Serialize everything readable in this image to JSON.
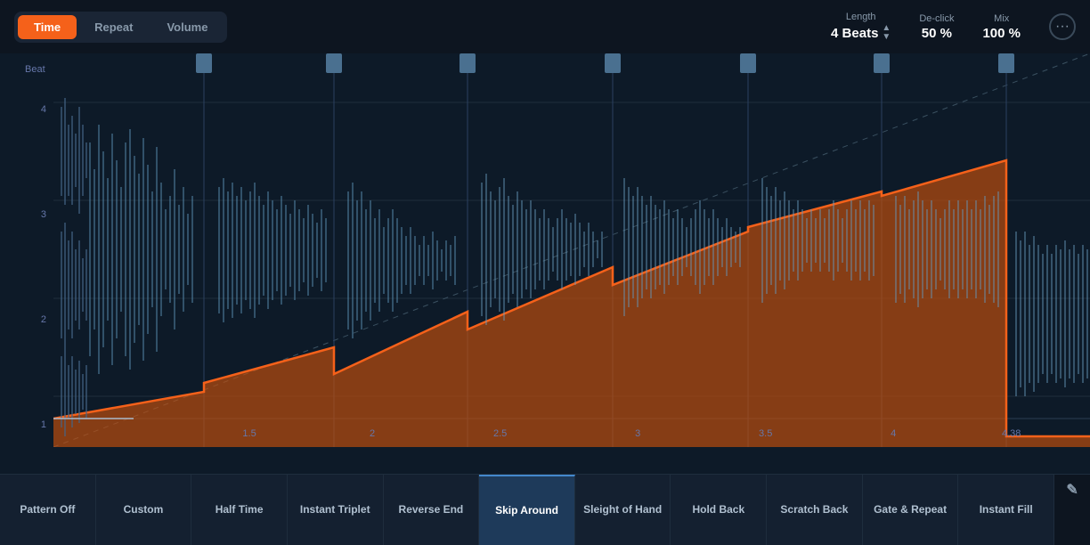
{
  "header": {
    "tabs": [
      {
        "label": "Time",
        "active": true
      },
      {
        "label": "Repeat",
        "active": false
      },
      {
        "label": "Volume",
        "active": false
      }
    ],
    "length_label": "Length",
    "length_value": "4 Beats",
    "declick_label": "De-click",
    "declick_value": "50 %",
    "mix_label": "Mix",
    "mix_value": "100 %",
    "more_icon": "⊕"
  },
  "viz": {
    "beat_label": "Beat",
    "y_labels": [
      "4",
      "3",
      "2",
      "1"
    ],
    "x_labels": [
      {
        "value": "1.5",
        "pct": 14.5
      },
      {
        "value": "2",
        "pct": 27
      },
      {
        "value": "2.5",
        "pct": 40
      },
      {
        "value": "3",
        "pct": 54
      },
      {
        "value": "3.5",
        "pct": 67
      },
      {
        "value": "4",
        "pct": 80
      },
      {
        "value": "4.38",
        "pct": 92
      }
    ]
  },
  "presets": [
    {
      "label": "Pattern Off",
      "active": false
    },
    {
      "label": "Custom",
      "active": false
    },
    {
      "label": "Half Time",
      "active": false
    },
    {
      "label": "Instant Triplet",
      "active": false
    },
    {
      "label": "Reverse End",
      "active": false
    },
    {
      "label": "Skip Around",
      "active": true
    },
    {
      "label": "Sleight of Hand",
      "active": false
    },
    {
      "label": "Hold Back",
      "active": false
    },
    {
      "label": "Scratch Back",
      "active": false
    },
    {
      "label": "Gate & Repeat",
      "active": false
    },
    {
      "label": "Instant Fill",
      "active": false
    },
    {
      "label": "✎",
      "active": false,
      "is_icon": true
    }
  ],
  "colors": {
    "active_tab": "#f5611a",
    "accent_orange": "#f5611a",
    "bg_dark": "#0d1520",
    "bg_viz": "#0d1a28",
    "active_preset_border": "#4488cc",
    "grid_line": "#1e2d3d"
  }
}
